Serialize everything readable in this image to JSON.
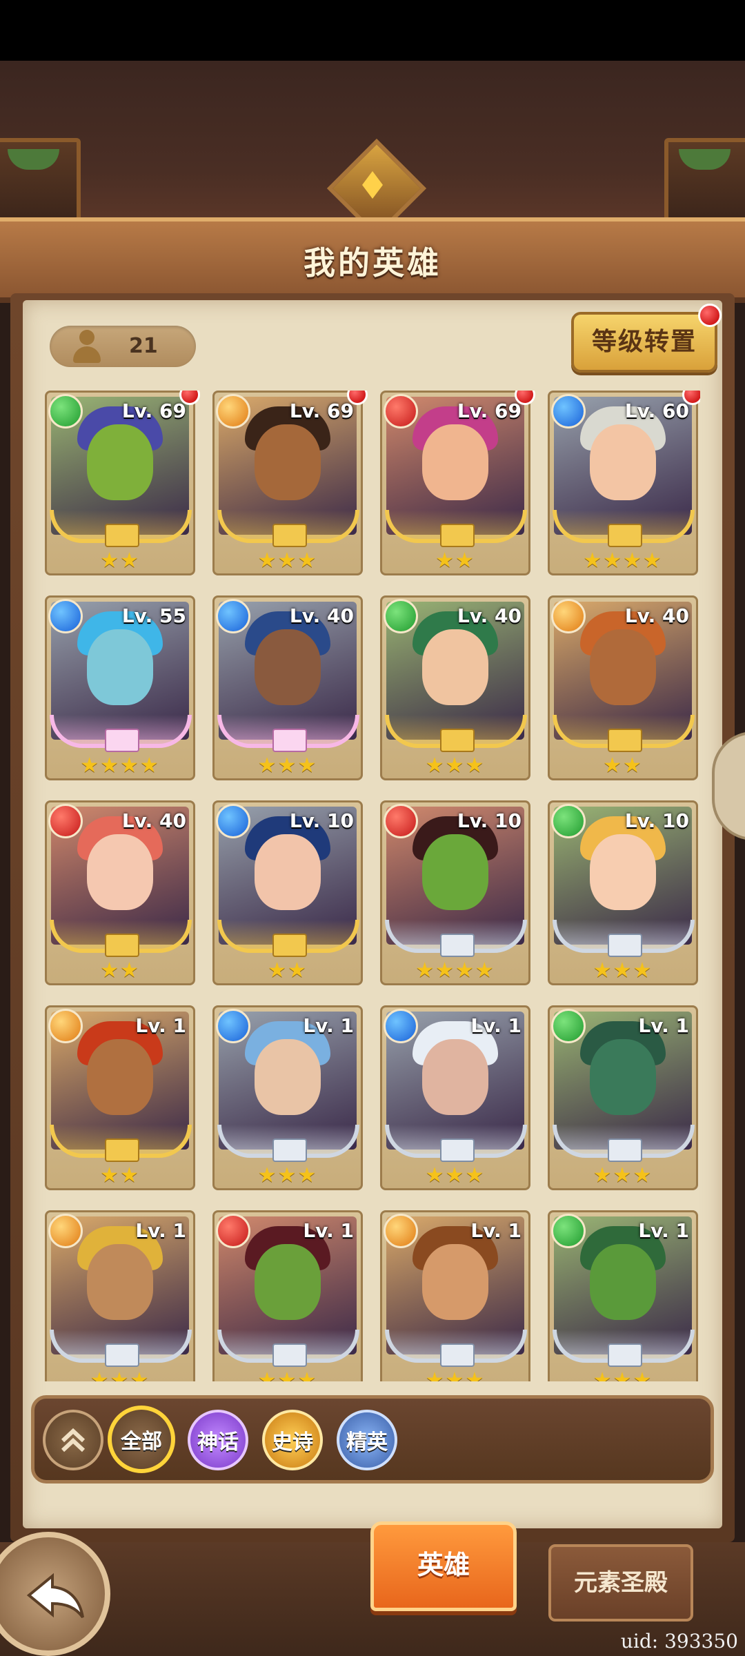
{
  "header": {
    "title": "我的英雄"
  },
  "hero_count": "21",
  "level_transfer_label": "等级转置",
  "colors": {
    "nature": "#1f9a2e",
    "water": "#1860d8",
    "fire": "#c41818",
    "light": "#e07a12",
    "star": "#f5c21a",
    "notice": "#d21b1b"
  },
  "heroes": [
    {
      "level": "Lv. 69",
      "element": "nature",
      "stars": "★★",
      "frame": "gold",
      "notice": true,
      "skin": "#7fb03a",
      "hair": "#4a4aa8"
    },
    {
      "level": "Lv. 69",
      "element": "light",
      "stars": "★★★",
      "frame": "gold",
      "notice": true,
      "skin": "#a5683a",
      "hair": "#3a2418"
    },
    {
      "level": "Lv. 69",
      "element": "fire",
      "stars": "★★",
      "frame": "gold",
      "notice": true,
      "skin": "#f0b58f",
      "hair": "#c33e8a"
    },
    {
      "level": "Lv. 60",
      "element": "water",
      "stars": "★★★★",
      "frame": "gold",
      "notice": true,
      "skin": "#f3c5a4",
      "hair": "#d9d9d0"
    },
    {
      "level": "Lv. 55",
      "element": "water",
      "stars": "★★★★",
      "frame": "pink",
      "notice": false,
      "skin": "#7ec8d8",
      "hair": "#3fb6e8"
    },
    {
      "level": "Lv. 40",
      "element": "water",
      "stars": "★★★",
      "frame": "pink",
      "notice": false,
      "skin": "#8a5a3e",
      "hair": "#2a4a8a"
    },
    {
      "level": "Lv. 40",
      "element": "nature",
      "stars": "★★★",
      "frame": "gold",
      "notice": false,
      "skin": "#f0c4a0",
      "hair": "#2f7a4a"
    },
    {
      "level": "Lv. 40",
      "element": "light",
      "stars": "★★",
      "frame": "gold",
      "notice": false,
      "skin": "#b06a3a",
      "hair": "#c9652a"
    },
    {
      "level": "Lv. 40",
      "element": "fire",
      "stars": "★★",
      "frame": "gold",
      "notice": false,
      "skin": "#f5c8b0",
      "hair": "#e56a5a"
    },
    {
      "level": "Lv. 10",
      "element": "water",
      "stars": "★★",
      "frame": "gold",
      "notice": false,
      "skin": "#f2c4aa",
      "hair": "#1f3a7a"
    },
    {
      "level": "Lv. 10",
      "element": "fire",
      "stars": "★★★★",
      "frame": "silver",
      "notice": false,
      "skin": "#6aa83a",
      "hair": "#3a1a1a"
    },
    {
      "level": "Lv. 10",
      "element": "nature",
      "stars": "★★★",
      "frame": "silver",
      "notice": false,
      "skin": "#f7cdb0",
      "hair": "#f0b84a"
    },
    {
      "level": "Lv. 1",
      "element": "light",
      "stars": "★★",
      "frame": "gold",
      "notice": false,
      "skin": "#b07040",
      "hair": "#c93a1a"
    },
    {
      "level": "Lv. 1",
      "element": "water",
      "stars": "★★★",
      "frame": "silver",
      "notice": false,
      "skin": "#e9c4a6",
      "hair": "#7ab0e0"
    },
    {
      "level": "Lv. 1",
      "element": "water",
      "stars": "★★★",
      "frame": "silver",
      "notice": false,
      "skin": "#e0b4a0",
      "hair": "#e8eef5"
    },
    {
      "level": "Lv. 1",
      "element": "nature",
      "stars": "★★★",
      "frame": "silver",
      "notice": false,
      "skin": "#3a7a5a",
      "hair": "#2a5a44"
    },
    {
      "level": "Lv. 1",
      "element": "light",
      "stars": "★★★",
      "frame": "silver",
      "notice": false,
      "skin": "#c08a5a",
      "hair": "#e0b23a"
    },
    {
      "level": "Lv. 1",
      "element": "fire",
      "stars": "★★★",
      "frame": "silver",
      "notice": false,
      "skin": "#6aa03a",
      "hair": "#5a1a22"
    },
    {
      "level": "Lv. 1",
      "element": "light",
      "stars": "★★★",
      "frame": "silver",
      "notice": false,
      "skin": "#d69a6a",
      "hair": "#8a4a20"
    },
    {
      "level": "Lv. 1",
      "element": "nature",
      "stars": "★★★",
      "frame": "silver",
      "notice": false,
      "skin": "#5a9a3a",
      "hair": "#2f6a3a"
    }
  ],
  "filters": {
    "collapse_icon": "double-chevron-up-icon",
    "all": "全部",
    "myth": "神话",
    "epic": "史诗",
    "elite": "精英"
  },
  "bottom_tabs": {
    "heroes": "英雄",
    "temple": "元素圣殿"
  },
  "back_icon": "back-arrow-icon",
  "uid": "uid: 393350"
}
